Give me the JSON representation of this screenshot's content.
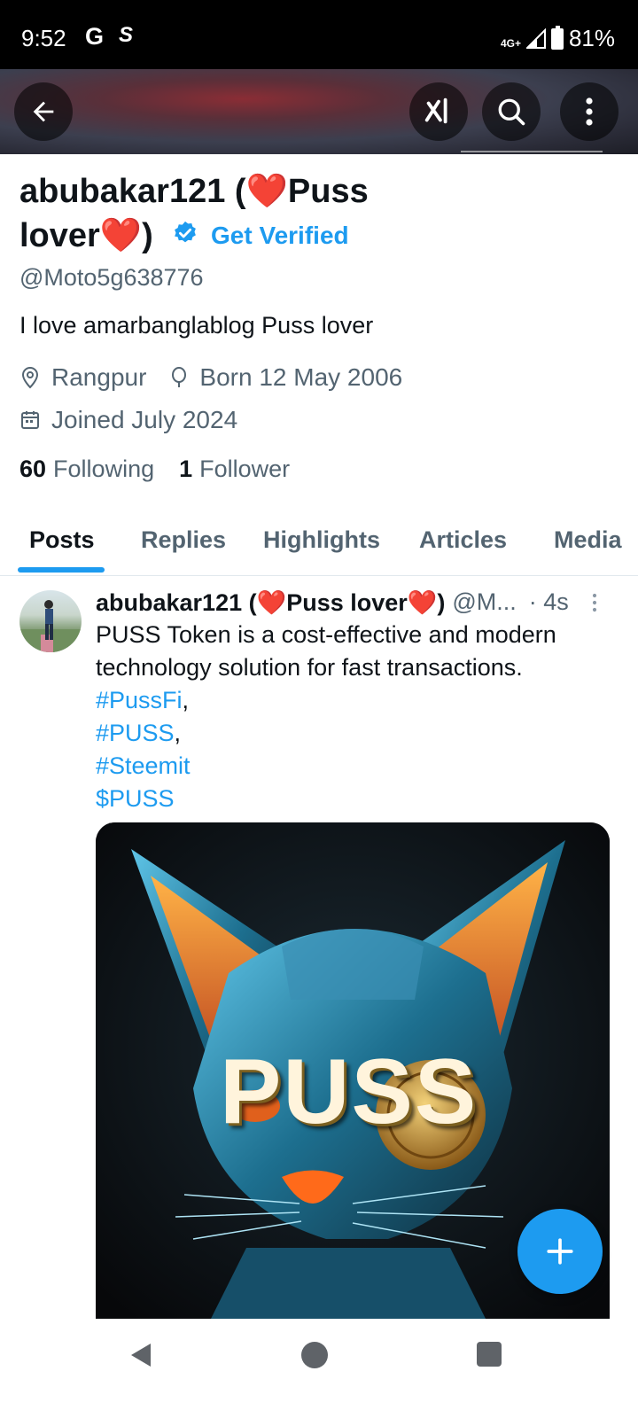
{
  "status_bar": {
    "time": "9:52",
    "network": "4G+",
    "battery": "81%"
  },
  "profile": {
    "name_line1": "abubakar121 (❤️Puss",
    "name_line2": "lover❤️)",
    "get_verified": "Get Verified",
    "handle": "@Moto5g638776",
    "bio": "I love amarbanglablog  Puss lover",
    "location": "Rangpur",
    "born": "Born 12 May 2006",
    "joined": "Joined July 2024",
    "following_count": "60",
    "following_label": "Following",
    "followers_count": "1",
    "followers_label": "Follower"
  },
  "tabs": [
    "Posts",
    "Replies",
    "Highlights",
    "Articles",
    "Media"
  ],
  "post": {
    "author": "abubakar121 (❤️Puss lover❤️)",
    "handle": "@M...",
    "time": "· 4s",
    "text_line1": "PUSS Token is a cost-effective and modern",
    "text_line2": "technology solution for fast transactions.",
    "tag1": "#PussFi",
    "comma1": ",",
    "tag2": "#PUSS",
    "comma2": ",",
    "tag3": "#Steemit",
    "tag4": "$PUSS",
    "image_text": "PUSS"
  },
  "icons": {
    "back": "arrow-left-icon",
    "grok": "grok-icon",
    "search": "search-icon",
    "more": "more-vertical-icon",
    "compose": "plus-icon"
  },
  "colors": {
    "accent": "#1d9bf0",
    "secondary_text": "#536471"
  }
}
